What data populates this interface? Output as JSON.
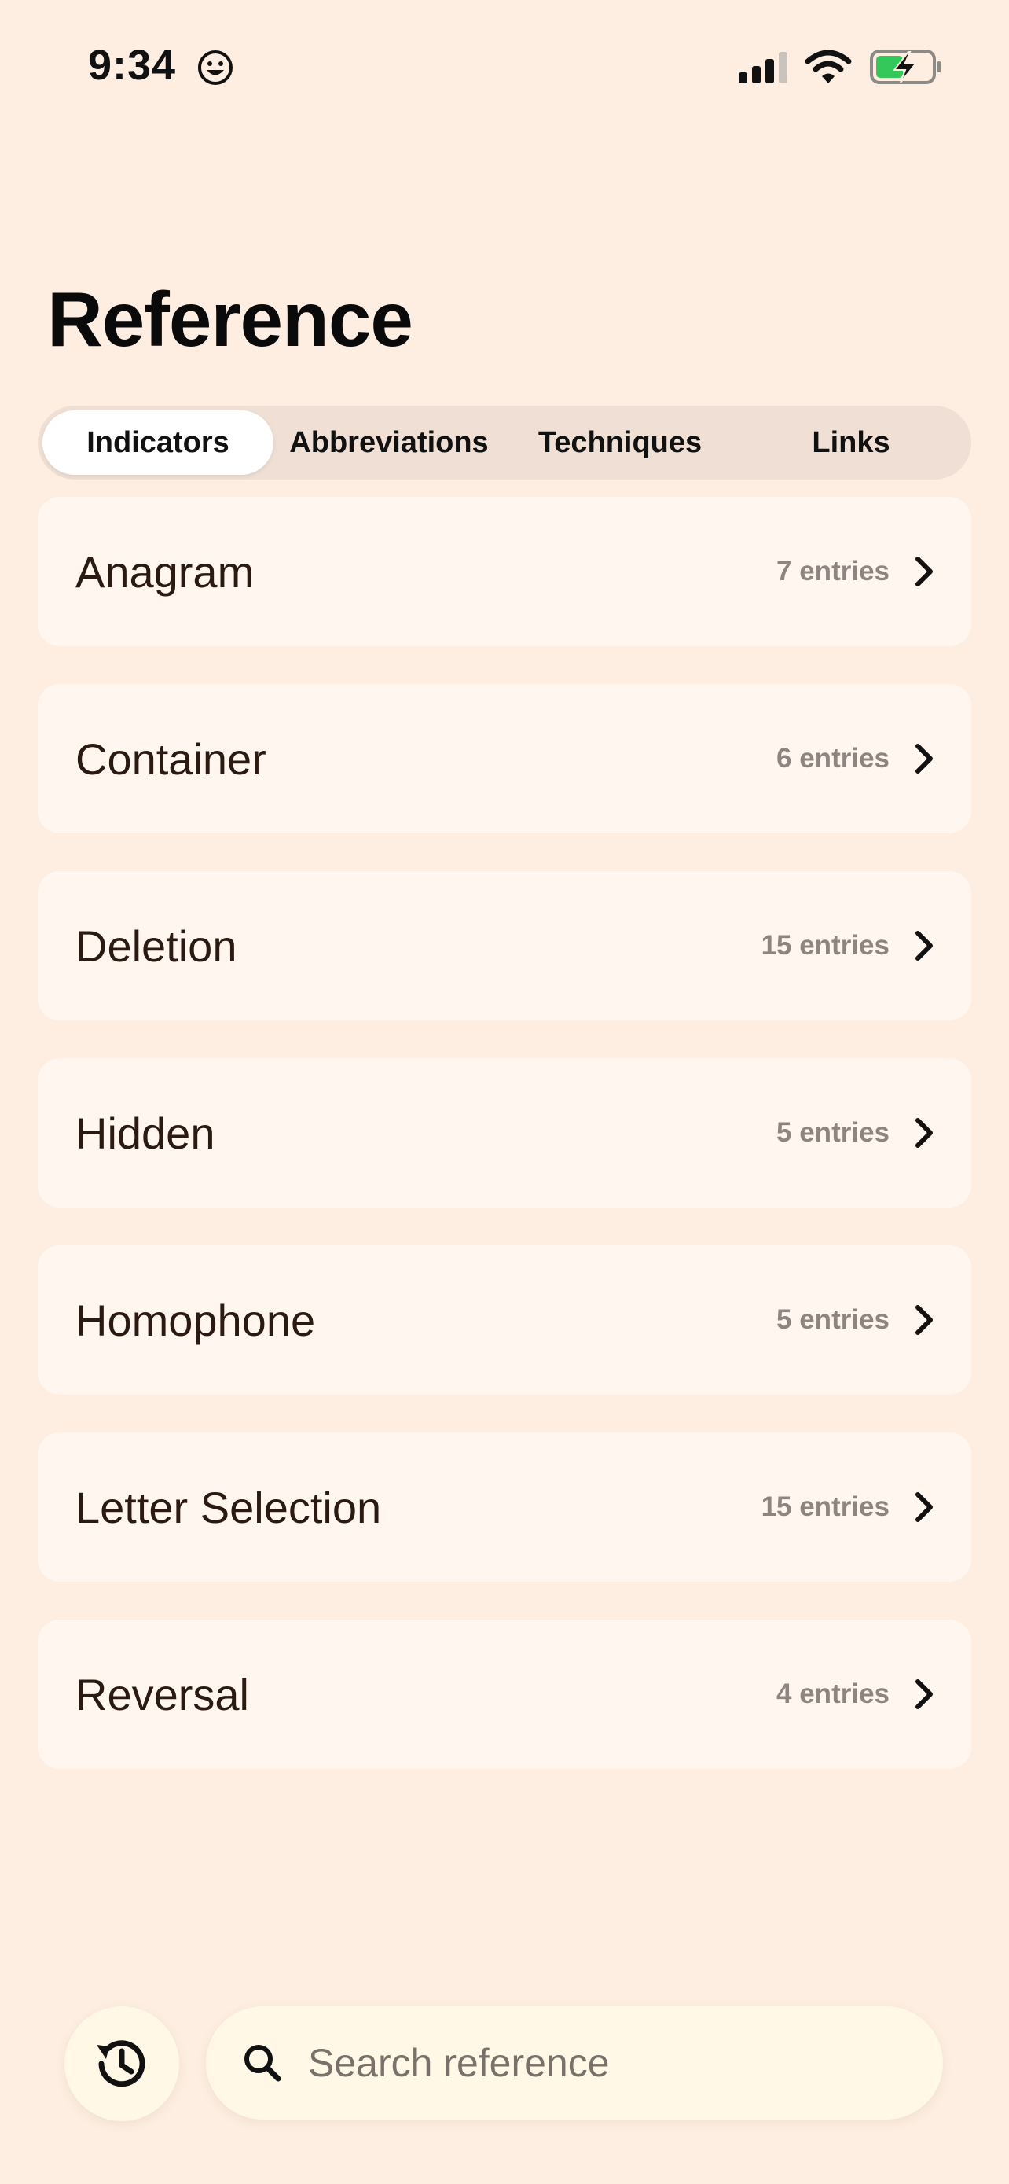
{
  "status_bar": {
    "time": "9:34",
    "emoji_icon": "smiley-face-icon",
    "signal_icon": "cellular-signal-icon",
    "wifi_icon": "wifi-icon",
    "battery_icon": "battery-charging-icon",
    "battery_color": "#34c759"
  },
  "page": {
    "title": "Reference"
  },
  "tabs": [
    {
      "label": "Indicators",
      "active": true
    },
    {
      "label": "Abbreviations",
      "active": false
    },
    {
      "label": "Techniques",
      "active": false
    },
    {
      "label": "Links",
      "active": false
    }
  ],
  "items": [
    {
      "label": "Anagram",
      "count": "7 entries"
    },
    {
      "label": "Container",
      "count": "6 entries"
    },
    {
      "label": "Deletion",
      "count": "15 entries"
    },
    {
      "label": "Hidden",
      "count": "5 entries"
    },
    {
      "label": "Homophone",
      "count": "5 entries"
    },
    {
      "label": "Letter Selection",
      "count": "15 entries"
    },
    {
      "label": "Reversal",
      "count": "4 entries"
    }
  ],
  "search": {
    "placeholder": "Search reference",
    "value": ""
  },
  "icons": {
    "chevron": "chevron-right-icon",
    "history": "history-icon",
    "search": "search-icon"
  },
  "colors": {
    "background": "#fdeee1",
    "card": "#fff6ef",
    "tab_track": "#efdfd4",
    "search_bg": "#fff8e6"
  }
}
